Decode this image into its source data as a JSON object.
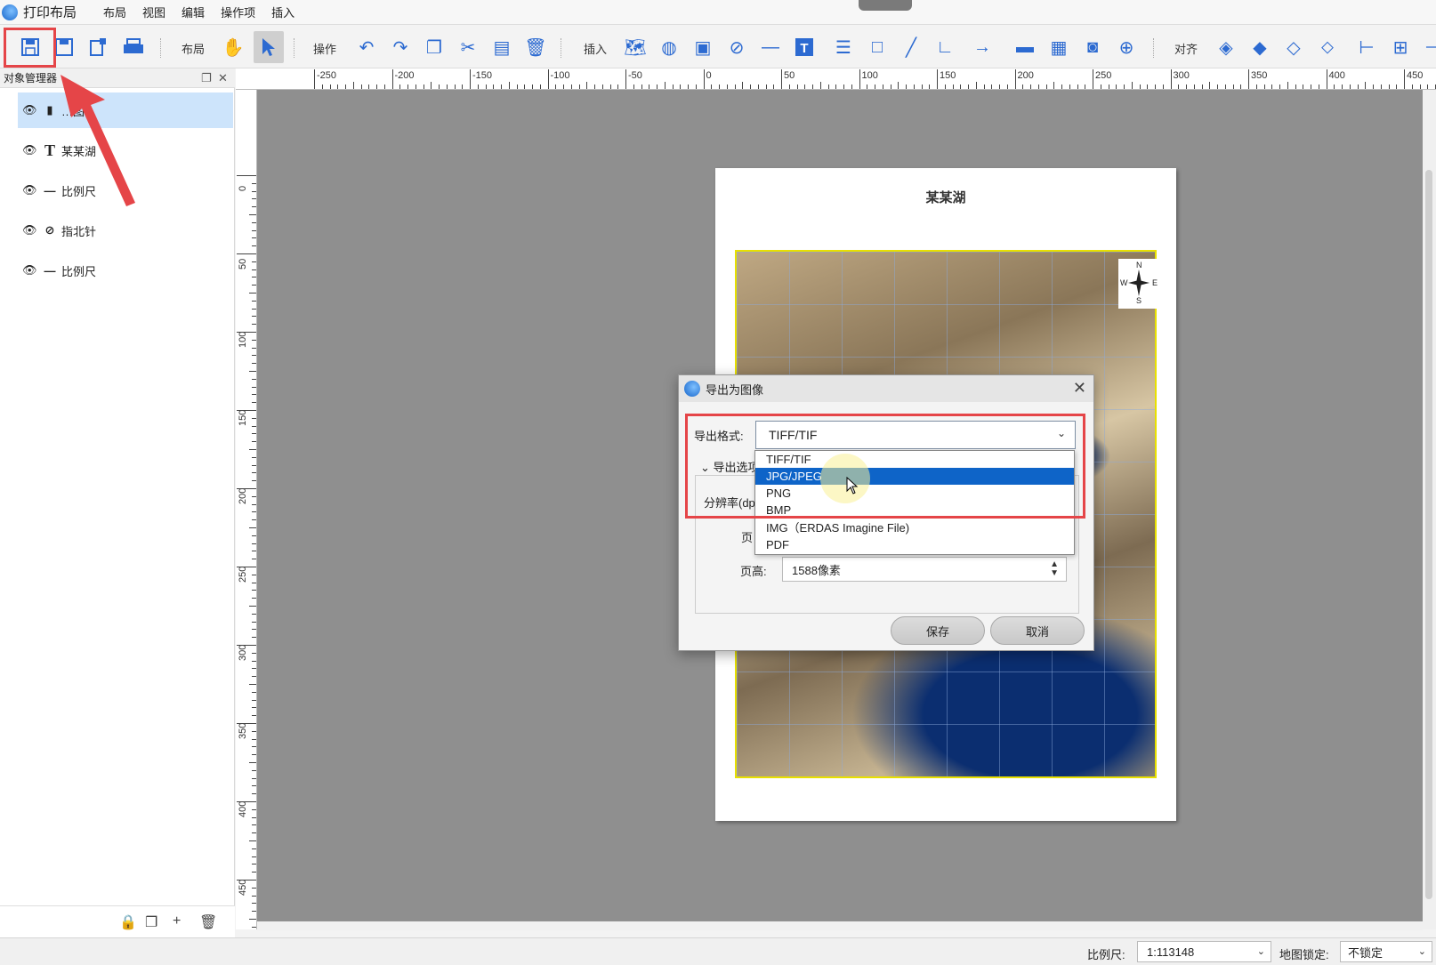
{
  "app": {
    "title": "打印布局"
  },
  "menu": [
    "布局",
    "视图",
    "编辑",
    "操作项",
    "插入"
  ],
  "toolbar": {
    "layout_label": "布局",
    "operate_label": "操作",
    "insert_label": "插入",
    "align_label": "对齐"
  },
  "object_manager": {
    "title": "对象管理器",
    "items": [
      {
        "icon": "map-icon",
        "label": "…图",
        "selected": true
      },
      {
        "icon": "text-icon",
        "label": "某某湖",
        "selected": false
      },
      {
        "icon": "scale-bar-icon",
        "label": "比例尺",
        "selected": false
      },
      {
        "icon": "north-arrow-icon",
        "label": "指北针",
        "selected": false
      },
      {
        "icon": "scale-bar-icon",
        "label": "比例尺",
        "selected": false
      }
    ]
  },
  "ruler_h": [
    "-250",
    "-200",
    "-150",
    "-100",
    "-50",
    "0",
    "50",
    "100",
    "150",
    "200",
    "250",
    "300",
    "350",
    "400",
    "450"
  ],
  "ruler_v": [
    "0",
    "50",
    "100",
    "150",
    "200",
    "250",
    "300",
    "350",
    "400",
    "450"
  ],
  "paper": {
    "title": "某某湖",
    "compass": {
      "n": "N",
      "s": "S",
      "w": "W",
      "e": "E"
    }
  },
  "dialog": {
    "title": "导出为图像",
    "format_label": "导出格式:",
    "format_value": "TIFF/TIF",
    "options_label": "导出选项",
    "dpi_label": "分辨率(dpi)",
    "page_width_label": "页",
    "page_height_label": "页高:",
    "page_height_value": "1588像素",
    "save_button": "保存",
    "cancel_button": "取消",
    "format_options": [
      "TIFF/TIF",
      "JPG/JPEG",
      "PNG",
      "BMP",
      "IMG（ERDAS Imagine File)",
      "PDF"
    ],
    "highlighted_option": "JPG/JPEG"
  },
  "statusbar": {
    "scale_label": "比例尺:",
    "scale_value": "1:113148",
    "lock_label": "地图锁定:",
    "lock_value": "不锁定"
  },
  "colors": {
    "accent": "#0e64c8",
    "annotation_red": "#e54548",
    "canvas": "#8f8f8f",
    "map_border": "#e8e000"
  }
}
